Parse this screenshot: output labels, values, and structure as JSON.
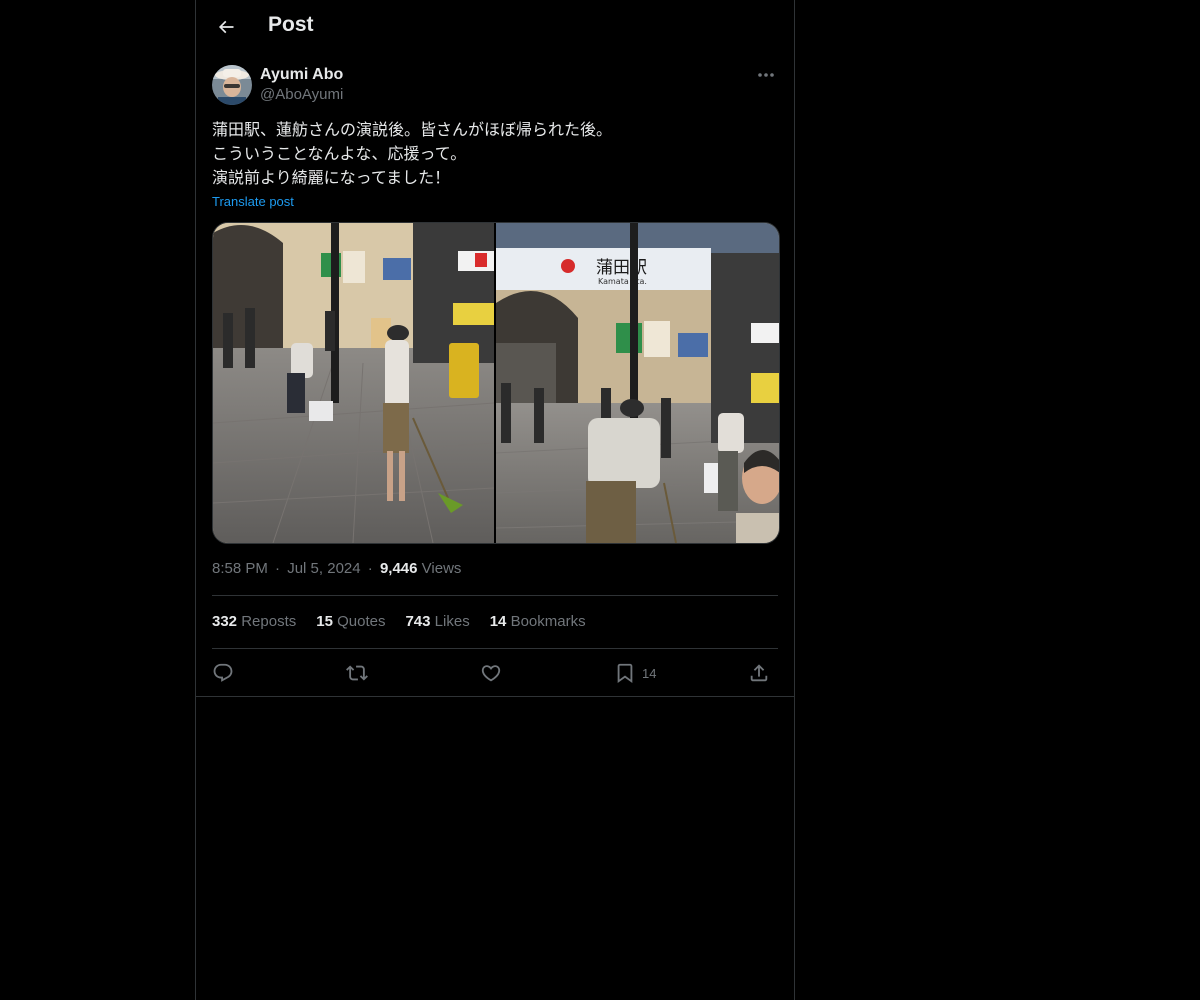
{
  "header": {
    "title": "Post"
  },
  "author": {
    "name": "Ayumi Abo",
    "handle": "@AboAyumi"
  },
  "post": {
    "lines": [
      "蒲田駅、蓮舫さんの演説後。皆さんがほぼ帰られた後。",
      "こういうことなんよな、応援って。",
      "演説前より綺麗になってました！"
    ],
    "translate_label": "Translate post"
  },
  "photos": {
    "right_sign_jp": "蒲田駅",
    "right_sign_en": "Kamata Sta."
  },
  "meta": {
    "time": "8:58 PM",
    "separator": "·",
    "date": "Jul 5, 2024",
    "views_count": "9,446",
    "views_label": "Views"
  },
  "stats": {
    "reposts_count": "332",
    "reposts_label": "Reposts",
    "quotes_count": "15",
    "quotes_label": "Quotes",
    "likes_count": "743",
    "likes_label": "Likes",
    "bookmarks_count": "14",
    "bookmarks_label": "Bookmarks"
  },
  "actions": {
    "bookmark_count": "14"
  },
  "icons": [
    "back-arrow-icon",
    "more-icon",
    "reply-icon",
    "repost-icon",
    "like-icon",
    "bookmark-icon",
    "share-icon"
  ],
  "colors": {
    "background": "#000000",
    "text": "#e7e9ea",
    "secondary": "#71767b",
    "link": "#1d9bf0",
    "border": "#2f3336"
  }
}
